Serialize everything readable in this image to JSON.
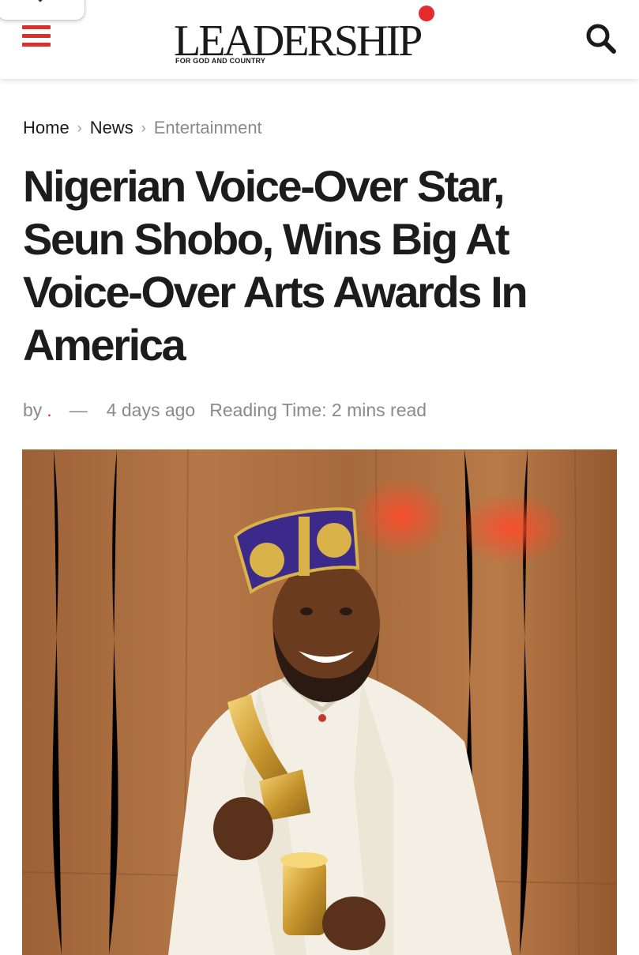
{
  "header": {
    "logo_text": "LEADERSHIP",
    "logo_tagline": "FOR GOD AND COUNTRY",
    "menu_icon": "hamburger-icon",
    "search_icon": "search-icon",
    "close_icon": "close-icon",
    "accent_color": "#d9302c"
  },
  "breadcrumb": {
    "items": [
      {
        "label": "Home"
      },
      {
        "label": "News"
      },
      {
        "label": "Entertainment"
      }
    ],
    "separator_icon": "chevron-right-icon"
  },
  "article": {
    "title": "Nigerian Voice-Over Star, Seun Shobo, Wins Big At Voice-Over Arts Awards In America",
    "meta": {
      "by_label": "by",
      "author": ".",
      "dash": "—",
      "time_ago": "4 days ago",
      "reading_time": "Reading Time: 2 mins read"
    }
  }
}
